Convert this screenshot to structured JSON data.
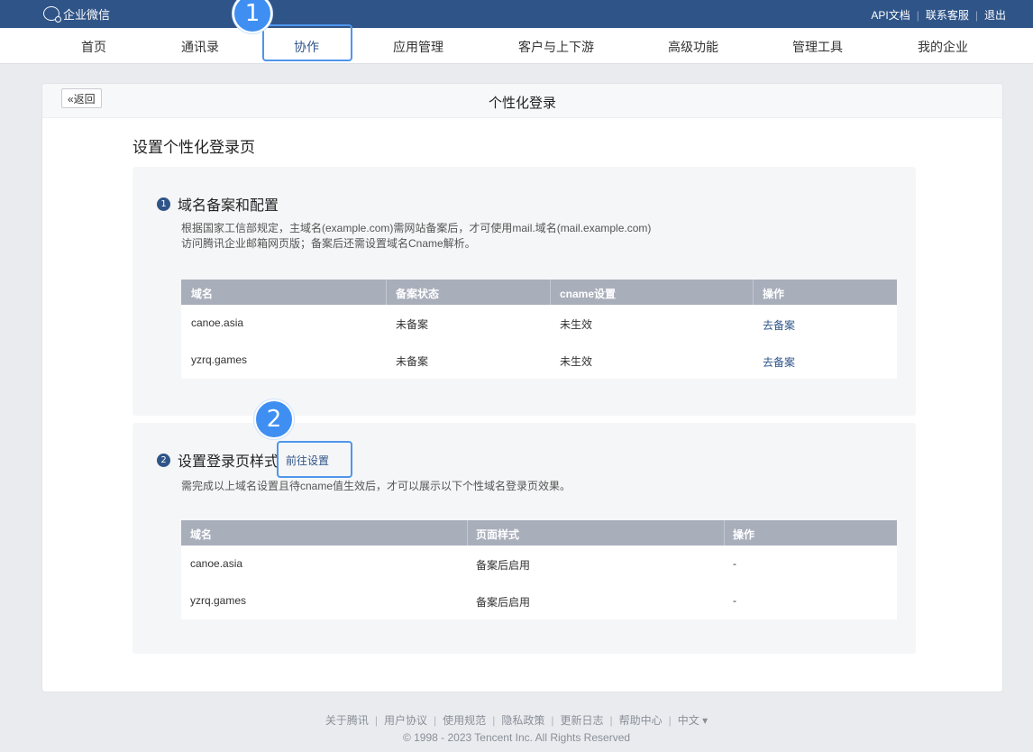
{
  "topbar": {
    "app_name": "企业微信",
    "links": [
      "API文档",
      "联系客服",
      "退出"
    ]
  },
  "nav": {
    "items": [
      "首页",
      "通讯录",
      "协作",
      "应用管理",
      "客户与上下游",
      "高级功能",
      "管理工具",
      "我的企业"
    ],
    "active": "协作"
  },
  "markers": [
    "1",
    "2"
  ],
  "page": {
    "back_label": "«返回",
    "title": "个性化登录",
    "section_title": "设置个性化登录页"
  },
  "step1": {
    "num": "1",
    "title": "域名备案和配置",
    "desc_line1": "根据国家工信部规定，主域名(example.com)需网站备案后，才可使用mail.域名(mail.example.com)",
    "desc_line2": "访问腾讯企业邮箱网页版；备案后还需设置域名Cname解析。",
    "columns": [
      "域名",
      "备案状态",
      "cname设置",
      "操作"
    ],
    "rows": [
      [
        "canoe.asia",
        "未备案",
        "未生效",
        "去备案"
      ],
      [
        "yzrq.games",
        "未备案",
        "未生效",
        "去备案"
      ]
    ]
  },
  "step2": {
    "num": "2",
    "title": "设置登录页样式",
    "link": "前往设置",
    "desc": "需完成以上域名设置且待cname值生效后，才可以展示以下个性域名登录页效果。",
    "columns": [
      "域名",
      "页面样式",
      "操作"
    ],
    "rows": [
      [
        "canoe.asia",
        "备案后启用",
        "-"
      ],
      [
        "yzrq.games",
        "备案后启用",
        "-"
      ]
    ]
  },
  "footer": {
    "links": [
      "关于腾讯",
      "用户协议",
      "使用规范",
      "隐私政策",
      "更新日志",
      "帮助中心",
      "中文 ▾"
    ],
    "copyright": "© 1998 - 2023 Tencent Inc. All Rights Reserved"
  }
}
